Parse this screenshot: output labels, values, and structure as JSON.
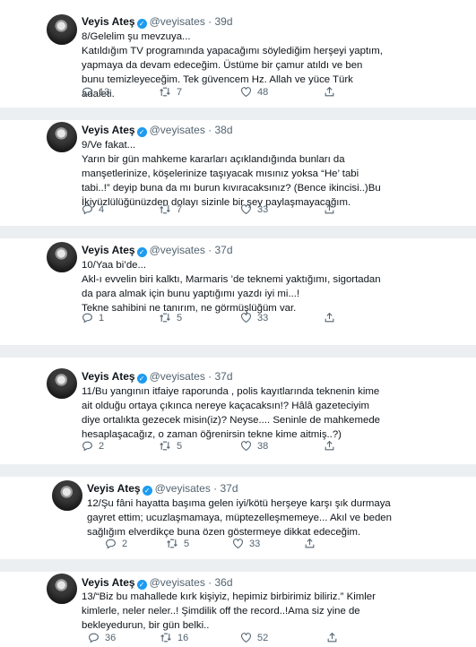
{
  "tweets": [
    {
      "name": "Veyis Ateş",
      "handle": "@veyisates",
      "time": "39d",
      "text": "8/Gelelim şu mevzuya...\nKatıldığım TV programında yapacağımı söylediğim herşeyi yaptım, yapmaya da devam edeceğim. Üstüme bir çamur atıldı ve ben bunu temizleyeceğim. Tek güvencem Hz. Allah ve yüce Türk adaleti.",
      "replies": "13",
      "retweets": "7",
      "likes": "48"
    },
    {
      "name": "Veyis Ateş",
      "handle": "@veyisates",
      "time": "38d",
      "text": "9/Ve fakat...\nYarın bir gün mahkeme kararları açıklandığında bunları da manşetlerinize, köşelerinize taşıyacak mısınız yoksa “He’ tabi tabi..!” deyip buna da mı burun kıvıracaksınız? (Bence ikincisi..)Bu İkiyüzlülüğünüzden dolayı sizinle bir şey paylaşmayacağım.",
      "replies": "4",
      "retweets": "7",
      "likes": "33"
    },
    {
      "name": "Veyis Ateş",
      "handle": "@veyisates",
      "time": "37d",
      "text": "10/Yaa bi’de...\nAkl-ı evvelin biri kalktı, Marmaris ’de teknemi yaktığımı, sigortadan da para almak için bunu yaptığımı yazdı iyi mi...!\nTekne sahibini ne tanırım, ne görmüşlüğüm var.",
      "replies": "1",
      "retweets": "5",
      "likes": "33"
    },
    {
      "name": "Veyis Ateş",
      "handle": "@veyisates",
      "time": "37d",
      "text": "11/Bu yangının itfaiye raporunda , polis kayıtlarında teknenin kime ait olduğu ortaya çıkınca nereye kaçacaksın!? Hâlâ gazeteciyim diye ortalıkta gezecek misin(iz)? Neyse.... Seninle de mahkemede hesaplaşacağız, o zaman öğrenirsin tekne kime aitmiş..?)",
      "replies": "2",
      "retweets": "5",
      "likes": "38"
    },
    {
      "name": "Veyis Ateş",
      "handle": "@veyisates",
      "time": "37d",
      "text": "12/Şu fâni hayatta başıma gelen iyi/kötü herşeye karşı şık durmaya gayret ettim; ucuzlaşmamaya, müptezelleşmemeye... Akıl ve beden sağlığım elverdikçe buna özen göstermeye dikkat edeceğim.",
      "replies": "2",
      "retweets": "5",
      "likes": "33"
    },
    {
      "name": "Veyis Ateş",
      "handle": "@veyisates",
      "time": "36d",
      "text": "13/“Biz bu mahallede kırk kişiyiz, hepimiz birbirimiz biliriz.” Kimler kimlerle, neler neler..! Şimdilik off the record..!Ama siz yine de bekleyedurun, bir gün belki..",
      "replies": "36",
      "retweets": "16",
      "likes": "52"
    }
  ]
}
